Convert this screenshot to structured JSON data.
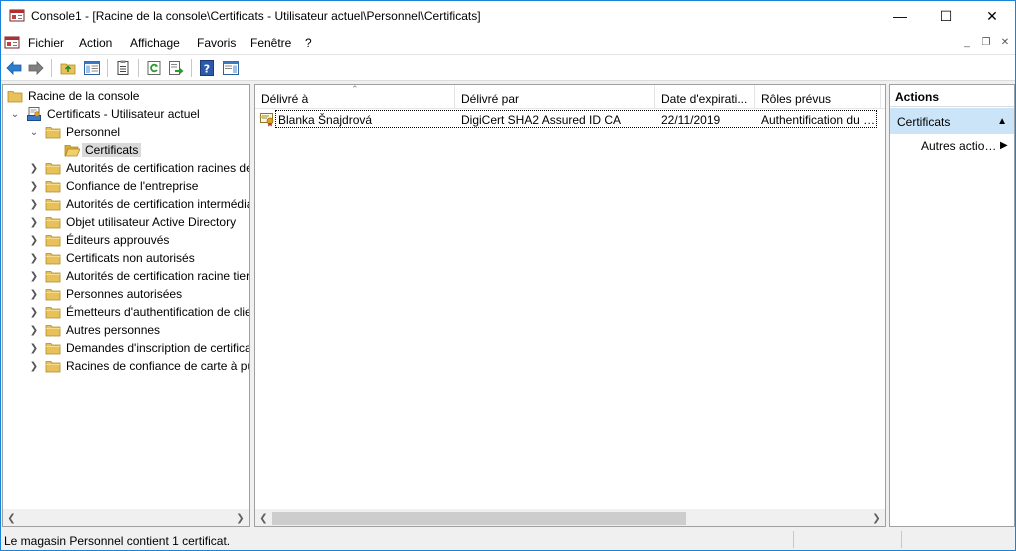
{
  "window": {
    "title": "Console1 - [Racine de la console\\Certificats - Utilisateur actuel\\Personnel\\Certificats]",
    "minimize_glyph": "—",
    "maximize_glyph": "☐",
    "close_glyph": "✕"
  },
  "menu": {
    "items": [
      "Fichier",
      "Action",
      "Affichage",
      "Favoris",
      "Fenêtre",
      "?"
    ],
    "mdi_minimize": "_",
    "mdi_restore": "❐",
    "mdi_close": "✕"
  },
  "toolbar": {
    "buttons": [
      "back-icon",
      "forward-icon",
      "up-folder-icon",
      "show-hide-tree-icon",
      "properties-icon",
      "refresh-icon",
      "export-list-icon",
      "help-icon",
      "show-hide-action-pane-icon"
    ]
  },
  "tree": {
    "root": "Racine de la console",
    "snapin": "Certificats - Utilisateur actuel",
    "personnel": "Personnel",
    "certificats": "Certificats",
    "stores": [
      "Autorités de certification racines de confiance",
      "Confiance de l'entreprise",
      "Autorités de certification intermédiaires",
      "Objet utilisateur Active Directory",
      "Éditeurs approuvés",
      "Certificats non autorisés",
      "Autorités de certification racine tierce partie",
      "Personnes autorisées",
      "Émetteurs d'authentification de client",
      "Autres personnes",
      "Demandes d'inscription de certificat",
      "Racines de confiance de carte à puce"
    ]
  },
  "list": {
    "columns": [
      "Délivré à",
      "Délivré par",
      "Date d'expirati...",
      "Rôles prévus"
    ],
    "rows": [
      {
        "issued_to": "Blanka Šnajdrová",
        "issued_by": "DigiCert SHA2 Assured ID CA",
        "expiration": "22/11/2019",
        "purposes": "Authentification du client, Messagerie sécurisée"
      }
    ]
  },
  "actions": {
    "header": "Actions",
    "section": "Certificats",
    "item": "Autres actions"
  },
  "status": {
    "text": "Le magasin Personnel contient 1 certificat."
  },
  "colors": {
    "selection": "#cce4f7",
    "window_border": "#1883d7",
    "folder": "#e8c15a"
  }
}
